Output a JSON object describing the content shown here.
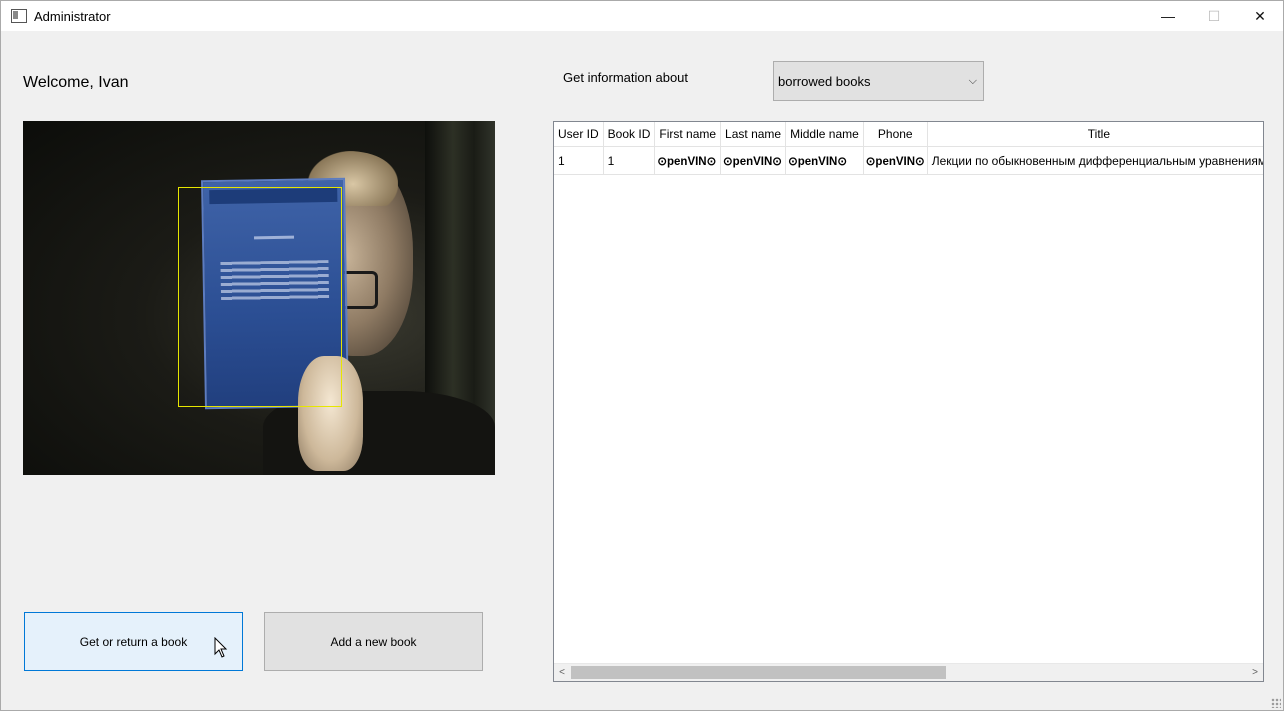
{
  "window": {
    "title": "Administrator",
    "minimize_glyph": "—",
    "maximize_glyph": "☐",
    "close_glyph": "✕"
  },
  "welcome_text": "Welcome, Ivan",
  "camera": {
    "icon": "webcam-feed"
  },
  "buttons": {
    "get_or_return": "Get or return a book",
    "add_new": "Add a new book"
  },
  "info": {
    "label": "Get information about",
    "selected": "borrowed books",
    "chevron": "⌵"
  },
  "table": {
    "headers": [
      "User ID",
      "Book ID",
      "First name",
      "Last name",
      "Middle name",
      "Phone",
      "Title"
    ],
    "rows": [
      [
        "1",
        "1",
        "⊙penVIN⊙",
        "⊙penVIN⊙",
        "⊙penVIN⊙",
        "⊙penVIN⊙",
        "Лекции по обыкновенным дифференциальным уравнениям"
      ]
    ]
  },
  "scrollbar": {
    "left_arrow": "<",
    "right_arrow": ">"
  }
}
